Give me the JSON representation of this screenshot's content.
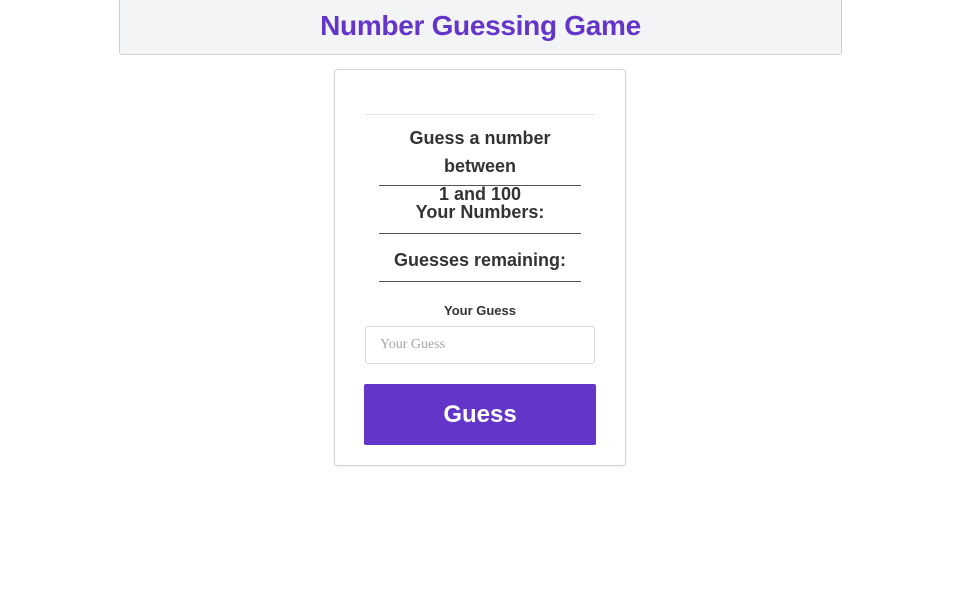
{
  "header": {
    "title": "Number Guessing Game"
  },
  "game": {
    "prompt_line1": "Guess a number between",
    "prompt_line2": "1 and 100",
    "numbers_label": "Your Numbers:",
    "remaining_label": "Guesses remaining:"
  },
  "form": {
    "field_label": "Your Guess",
    "input_placeholder": "Your Guess",
    "input_value": "",
    "button_label": "Guess"
  },
  "colors": {
    "accent": "#6435c9",
    "header_bg": "#f3f4f6"
  }
}
